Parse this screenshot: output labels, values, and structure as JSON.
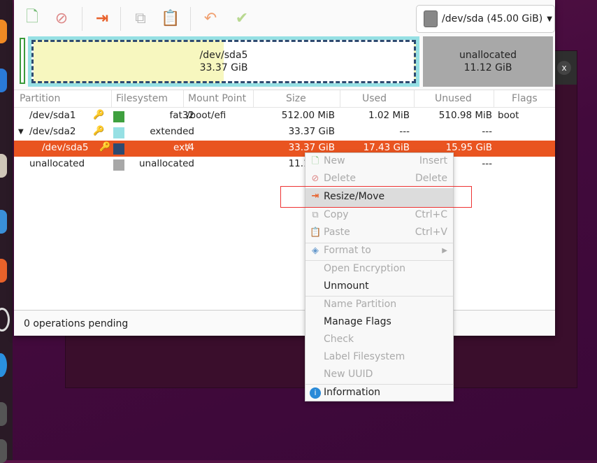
{
  "toolbar": {
    "device": "/dev/sda (45.00 GiB)"
  },
  "disk_map": {
    "sda5_name": "/dev/sda5",
    "sda5_size": "33.37 GiB",
    "unalloc_name": "unallocated",
    "unalloc_size": "11.12 GiB",
    "sda5_used_fraction": 0.52
  },
  "columns": [
    "Partition",
    "Filesystem",
    "Mount Point",
    "Size",
    "Used",
    "Unused",
    "Flags"
  ],
  "rows": [
    {
      "partition": "/dev/sda1",
      "filesystem": "fat32",
      "color": "#3fa03f",
      "mount": "/boot/efi",
      "size": "512.00 MiB",
      "used": "1.02 MiB",
      "unused": "510.98 MiB",
      "flags": "boot"
    },
    {
      "partition": "/dev/sda2",
      "filesystem": "extended",
      "color": "#96e0e4",
      "mount": "",
      "size": "33.37 GiB",
      "used": "---",
      "unused": "---",
      "flags": ""
    },
    {
      "partition": "/dev/sda5",
      "filesystem": "ext4",
      "color": "#2e4a70",
      "mount": "/",
      "size": "33.37 GiB",
      "used": "17.43 GiB",
      "unused": "15.95 GiB",
      "flags": "",
      "selected": true
    },
    {
      "partition": "unallocated",
      "filesystem": "unallocated",
      "color": "#a8a8a8",
      "mount": "",
      "size": "11.12 GiB",
      "used": "---",
      "unused": "---",
      "flags": ""
    }
  ],
  "status": "0 operations pending",
  "menu": {
    "new": {
      "label": "New",
      "accel": "Insert"
    },
    "delete": {
      "label": "Delete",
      "accel": "Delete"
    },
    "resize": {
      "label": "Resize/Move"
    },
    "copy": {
      "label": "Copy",
      "accel": "Ctrl+C"
    },
    "paste": {
      "label": "Paste",
      "accel": "Ctrl+V"
    },
    "format": {
      "label": "Format to"
    },
    "open_enc": {
      "label": "Open Encryption"
    },
    "unmount": {
      "label": "Unmount"
    },
    "name": {
      "label": "Name Partition"
    },
    "flags": {
      "label": "Manage Flags"
    },
    "check": {
      "label": "Check"
    },
    "label_fs": {
      "label": "Label Filesystem"
    },
    "uuid": {
      "label": "New UUID"
    },
    "info": {
      "label": "Information"
    }
  },
  "accent": "#e95420",
  "behind_close": "x"
}
